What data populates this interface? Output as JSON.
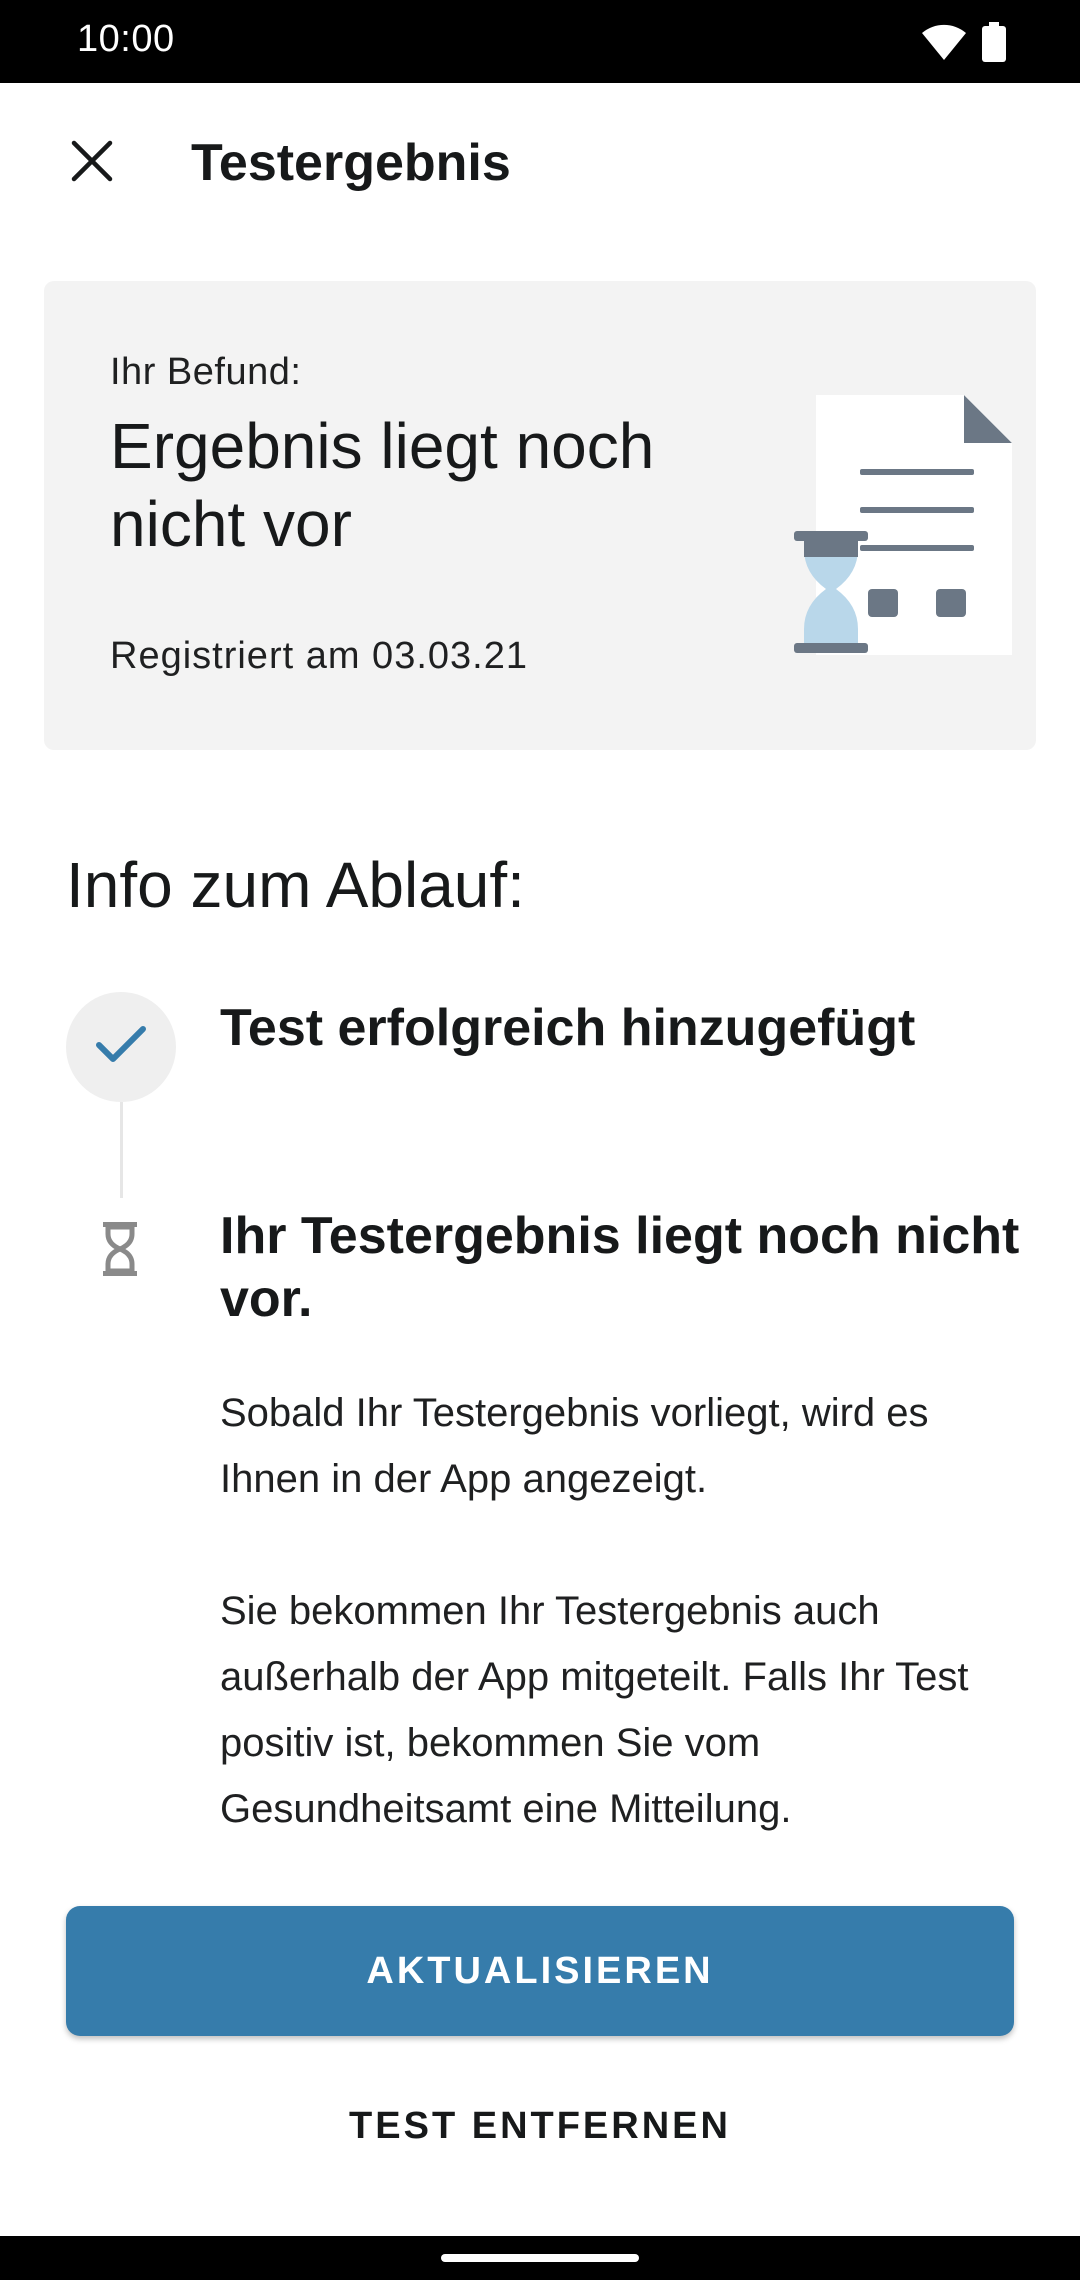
{
  "status_bar": {
    "time": "10:00",
    "wifi_icon": "wifi-icon",
    "battery_icon": "battery-icon"
  },
  "toolbar": {
    "close_icon": "close-icon",
    "title": "Testergebnis"
  },
  "result_card": {
    "label": "Ihr Befund:",
    "headline": "Ergebnis liegt noch nicht vor",
    "registered": "Registriert am 03.03.21",
    "illustration": "document-hourglass-illustration"
  },
  "info": {
    "title": "Info zum Ablauf:",
    "steps": [
      {
        "icon": "check-icon",
        "title": "Test erfolgreich hinzugefügt"
      },
      {
        "icon": "hourglass-icon",
        "title": "Ihr Testergebnis liegt noch nicht vor.",
        "body": [
          "Sobald Ihr Testergebnis vorliegt, wird es Ihnen in der App angezeigt.",
          "Sie bekommen Ihr Testergebnis auch außerhalb der App mitgeteilt. Falls Ihr Test positiv ist, bekommen Sie vom Gesundheitsamt eine Mitteilung."
        ]
      }
    ]
  },
  "actions": {
    "primary": "AKTUALISIEREN",
    "secondary": "TEST ENTFERNEN"
  },
  "colors": {
    "accent": "#367cab",
    "card_background": "#f3f3f3",
    "illustration_gray": "#6b7785",
    "illustration_blue": "#b9d7ea"
  }
}
